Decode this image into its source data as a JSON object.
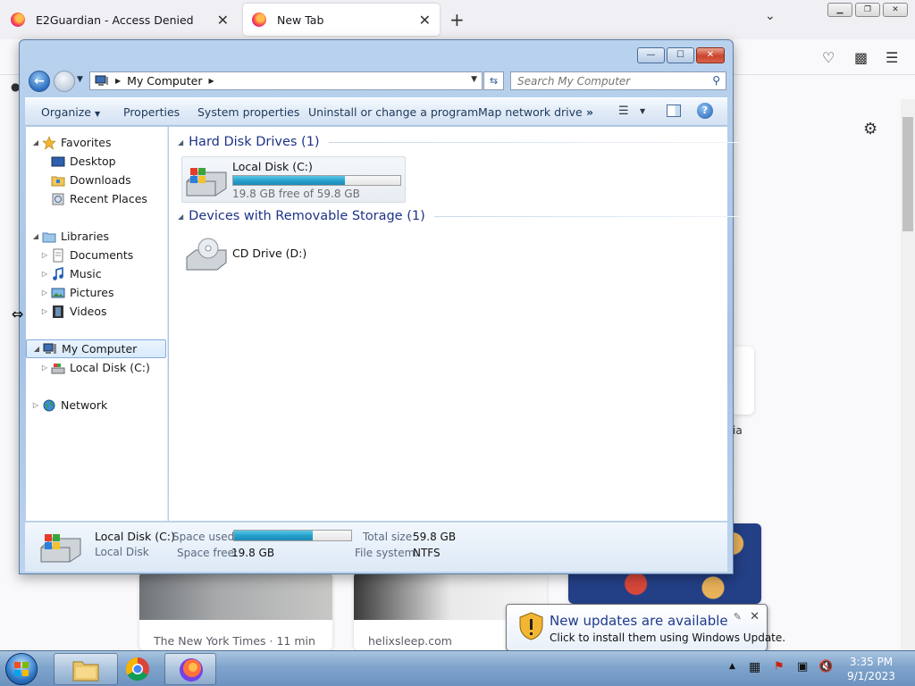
{
  "browser": {
    "tabs": [
      {
        "title": "E2Guardian - Access Denied",
        "close": "✕"
      },
      {
        "title": "New Tab",
        "close": "✕"
      }
    ],
    "new_tab": "+",
    "settings_icon": "gear-icon",
    "partial_text": "ia",
    "stories": [
      {
        "source": "The New York Times · 11 min"
      },
      {
        "source": "helixsleep.com"
      }
    ]
  },
  "explorer": {
    "window_controls": {
      "minimize": "—",
      "maximize": "☐",
      "close": "✕"
    },
    "address": {
      "path": "My Computer"
    },
    "search": {
      "placeholder": "Search My Computer"
    },
    "commands": {
      "organize": "Organize",
      "properties": "Properties",
      "system_properties": "System properties",
      "uninstall": "Uninstall or change a program",
      "map_drive": "Map network drive",
      "more": "»"
    },
    "nav": {
      "favorites": "Favorites",
      "desktop": "Desktop",
      "downloads": "Downloads",
      "recent": "Recent Places",
      "libraries": "Libraries",
      "documents": "Documents",
      "music": "Music",
      "pictures": "Pictures",
      "videos": "Videos",
      "my_computer": "My Computer",
      "local_disk": "Local Disk (C:)",
      "network": "Network"
    },
    "groups": {
      "hdd": "Hard Disk Drives (1)",
      "removable": "Devices with Removable Storage (1)"
    },
    "drives": {
      "c": {
        "name": "Local Disk (C:)",
        "free_text": "19.8 GB free of 59.8 GB",
        "used_fraction": 0.669
      },
      "d": {
        "name": "CD Drive (D:)"
      }
    },
    "details": {
      "name": "Local Disk (C:)",
      "type": "Local Disk",
      "space_used_label": "Space used:",
      "space_free_label": "Space free:",
      "space_free": "19.8 GB",
      "total_label": "Total size:",
      "total": "59.8 GB",
      "fs_label": "File system:",
      "fs": "NTFS"
    }
  },
  "notification": {
    "title": "New updates are available",
    "subtitle": "Click to install them using Windows Update.",
    "close": "✕"
  },
  "taskbar": {
    "time": "3:35 PM",
    "date": "9/1/2023"
  },
  "colors": {
    "progress_fill": "#27a2cd",
    "group_header": "#1e3287",
    "taskbar": "#7fa4cc"
  }
}
